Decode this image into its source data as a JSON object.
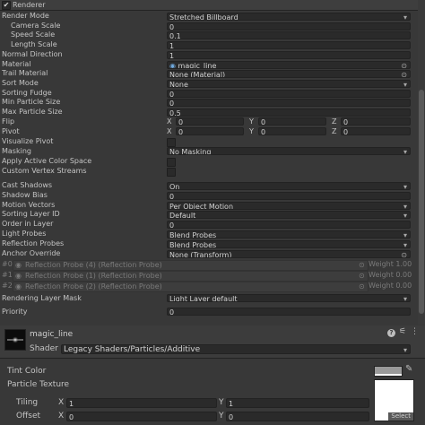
{
  "renderer": {
    "title": "Renderer",
    "checked": true
  },
  "rows": [
    {
      "label": "Render Mode",
      "value": "Stretched Billboard",
      "kind": "dropdown"
    },
    {
      "label": "Camera Scale",
      "value": "0",
      "kind": "text",
      "indent": true
    },
    {
      "label": "Speed Scale",
      "value": "0.1",
      "kind": "text",
      "indent": true
    },
    {
      "label": "Length Scale",
      "value": "1",
      "kind": "text",
      "indent": true
    },
    {
      "label": "Normal Direction",
      "value": "1",
      "kind": "text"
    },
    {
      "label": "Material",
      "value": "magic_line",
      "kind": "object"
    },
    {
      "label": "Trail Material",
      "value": "None (Material)",
      "kind": "object"
    },
    {
      "label": "Sort Mode",
      "value": "None",
      "kind": "dropdown"
    },
    {
      "label": "Sorting Fudge",
      "value": "0",
      "kind": "text"
    },
    {
      "label": "Min Particle Size",
      "value": "0",
      "kind": "text"
    },
    {
      "label": "Max Particle Size",
      "value": "0.5",
      "kind": "text"
    }
  ],
  "flip": {
    "label": "Flip",
    "x": "0",
    "y": "0",
    "z": "0"
  },
  "pivot": {
    "label": "Pivot",
    "x": "0",
    "y": "0",
    "z": "0"
  },
  "axes": {
    "x": "X",
    "y": "Y",
    "z": "Z"
  },
  "visualize_pivot": {
    "label": "Visualize Pivot"
  },
  "masking": {
    "label": "Masking",
    "value": "No Masking"
  },
  "apply_active_color_space": {
    "label": "Apply Active Color Space"
  },
  "custom_vertex_streams": {
    "label": "Custom Vertex Streams"
  },
  "rows2": [
    {
      "label": "Cast Shadows",
      "value": "On",
      "kind": "dropdown"
    },
    {
      "label": "Shadow Bias",
      "value": "0",
      "kind": "text"
    },
    {
      "label": "Motion Vectors",
      "value": "Per Object Motion",
      "kind": "dropdown"
    },
    {
      "label": "Sorting Layer ID",
      "value": "Default",
      "kind": "dropdown"
    },
    {
      "label": "Order in Layer",
      "value": "0",
      "kind": "text"
    },
    {
      "label": "Light Probes",
      "value": "Blend Probes",
      "kind": "dropdown"
    },
    {
      "label": "Reflection Probes",
      "value": "Blend Probes",
      "kind": "dropdown"
    },
    {
      "label": "Anchor Override",
      "value": "None (Transform)",
      "kind": "object"
    }
  ],
  "probes": [
    {
      "index": "#0",
      "name": "Reflection Probe (4) (Reflection Probe)",
      "weight": "Weight 1.00"
    },
    {
      "index": "#1",
      "name": "Reflection Probe (1) (Reflection Probe)",
      "weight": "Weight 0.00"
    },
    {
      "index": "#2",
      "name": "Reflection Probe (2) (Reflection Probe)",
      "weight": "Weight 0.00"
    }
  ],
  "rendering_layer_mask": {
    "label": "Rendering Layer Mask",
    "value": "Light Layer default"
  },
  "priority": {
    "label": "Priority",
    "value": "0"
  },
  "material": {
    "name": "magic_line",
    "shader_label": "Shader",
    "shader_value": "Legacy Shaders/Particles/Additive"
  },
  "shader_props": {
    "tint_color_label": "Tint Color",
    "tint_color": "#9a9a9a",
    "particle_texture_label": "Particle Texture",
    "tiling_label": "Tiling",
    "offset_label": "Offset",
    "tiling": {
      "x": "1",
      "y": "1"
    },
    "offset": {
      "x": "0",
      "y": "0"
    },
    "select_label": "Select"
  }
}
